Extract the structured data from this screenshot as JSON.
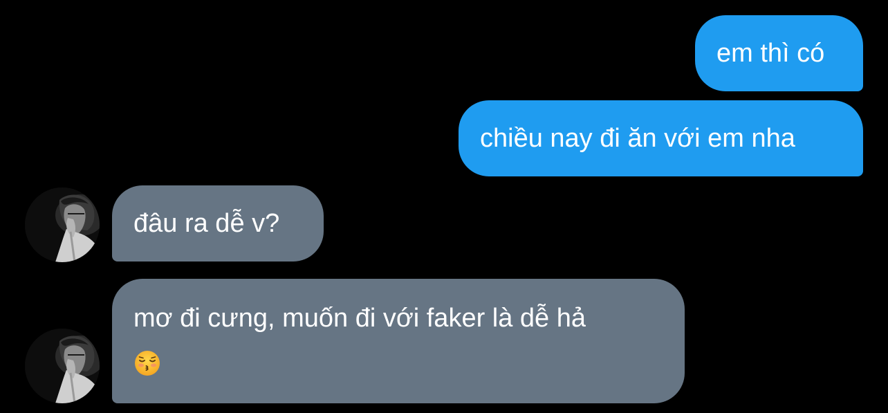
{
  "conversation": {
    "messages": [
      {
        "direction": "outgoing",
        "text": "em thì có"
      },
      {
        "direction": "outgoing",
        "text": "chiều nay đi ăn với em nha"
      },
      {
        "direction": "incoming",
        "text": "đâu ra dễ v?"
      },
      {
        "direction": "incoming",
        "text": "mơ đi cưng, muốn đi với faker là dễ hả",
        "emoji": "kissing-face-with-closed-eyes-icon"
      }
    ]
  },
  "colors": {
    "background": "#000000",
    "outgoing_bubble": "#1f9cf0",
    "incoming_bubble": "#667584",
    "text": "#ffffff"
  },
  "icons": {
    "avatar": "user-avatar-grayscale-photo"
  }
}
